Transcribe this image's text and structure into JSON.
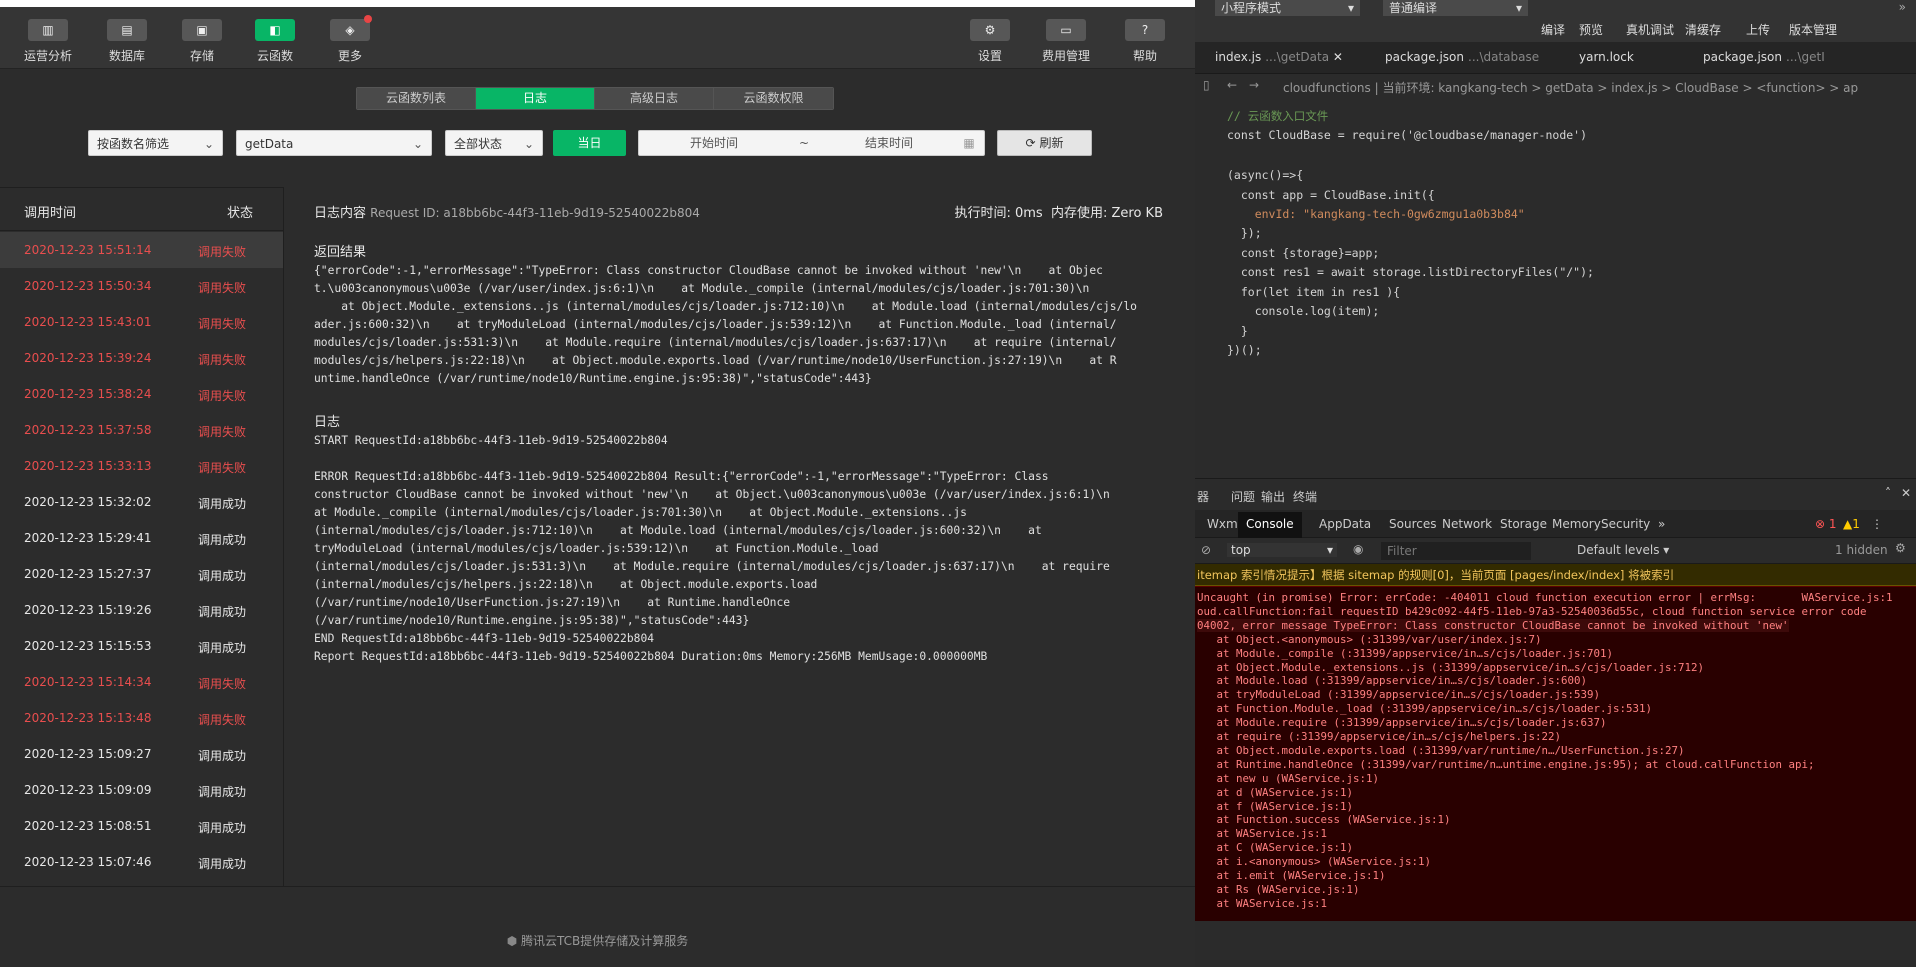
{
  "toolbar": {
    "items": [
      {
        "label": "运营分析",
        "icon": "bar-chart-icon"
      },
      {
        "label": "数据库",
        "icon": "database-icon"
      },
      {
        "label": "存储",
        "icon": "storage-icon"
      },
      {
        "label": "云函数",
        "icon": "cloud-function-icon"
      },
      {
        "label": "更多",
        "icon": "layers-icon"
      },
      {
        "label": "设置",
        "icon": "gear-icon"
      },
      {
        "label": "费用管理",
        "icon": "billing-icon"
      },
      {
        "label": "帮助",
        "icon": "help-icon"
      }
    ]
  },
  "tabs": [
    "云函数列表",
    "日志",
    "高级日志",
    "云函数权限"
  ],
  "filters": {
    "by_name": "按函数名筛选",
    "function": "getData",
    "status": "全部状态",
    "today": "当日",
    "start": "开始时间",
    "sep": "~",
    "end": "结束时间",
    "refresh": "刷新"
  },
  "list": {
    "col_time": "调用时间",
    "col_status": "状态",
    "rows": [
      {
        "time": "2020-12-23 15:51:14",
        "status": "调用失败"
      },
      {
        "time": "2020-12-23 15:50:34",
        "status": "调用失败"
      },
      {
        "time": "2020-12-23 15:43:01",
        "status": "调用失败"
      },
      {
        "time": "2020-12-23 15:39:24",
        "status": "调用失败"
      },
      {
        "time": "2020-12-23 15:38:24",
        "status": "调用失败"
      },
      {
        "time": "2020-12-23 15:37:58",
        "status": "调用失败"
      },
      {
        "time": "2020-12-23 15:33:13",
        "status": "调用失败"
      },
      {
        "time": "2020-12-23 15:32:02",
        "status": "调用成功"
      },
      {
        "time": "2020-12-23 15:29:41",
        "status": "调用成功"
      },
      {
        "time": "2020-12-23 15:27:37",
        "status": "调用成功"
      },
      {
        "time": "2020-12-23 15:19:26",
        "status": "调用成功"
      },
      {
        "time": "2020-12-23 15:15:53",
        "status": "调用成功"
      },
      {
        "time": "2020-12-23 15:14:34",
        "status": "调用失败"
      },
      {
        "time": "2020-12-23 15:13:48",
        "status": "调用失败"
      },
      {
        "time": "2020-12-23 15:09:27",
        "status": "调用成功"
      },
      {
        "time": "2020-12-23 15:09:09",
        "status": "调用成功"
      },
      {
        "time": "2020-12-23 15:08:51",
        "status": "调用成功"
      },
      {
        "time": "2020-12-23 15:07:46",
        "status": "调用成功"
      }
    ]
  },
  "detail": {
    "title": "日志内容",
    "request_id": "Request ID: a18bb6bc-44f3-11eb-9d19-52540022b804",
    "exec_time": "执行时间: 0ms",
    "memory": "内存使用: Zero KB",
    "result_title": "返回结果",
    "result_lines": [
      "{\"errorCode\":-1,\"errorMessage\":\"TypeError: Class constructor CloudBase cannot be invoked without 'new'\\n    at Objec",
      "t.\\u003canonymous\\u003e (/var/user/index.js:6:1)\\n    at Module._compile (internal/modules/cjs/loader.js:701:30)\\n",
      "    at Object.Module._extensions..js (internal/modules/cjs/loader.js:712:10)\\n    at Module.load (internal/modules/cjs/lo",
      "ader.js:600:32)\\n    at tryModuleLoad (internal/modules/cjs/loader.js:539:12)\\n    at Function.Module._load (internal/",
      "modules/cjs/loader.js:531:3)\\n    at Module.require (internal/modules/cjs/loader.js:637:17)\\n    at require (internal/",
      "modules/cjs/helpers.js:22:18)\\n    at Object.module.exports.load (/var/runtime/node10/UserFunction.js:27:19)\\n    at R",
      "untime.handleOnce (/var/runtime/node10/Runtime.engine.js:95:38)\",\"statusCode\":443}"
    ],
    "log_title": "日志",
    "log_lines": [
      "START RequestId:a18bb6bc-44f3-11eb-9d19-52540022b804",
      "",
      "ERROR RequestId:a18bb6bc-44f3-11eb-9d19-52540022b804 Result:{\"errorCode\":-1,\"errorMessage\":\"TypeError: Class",
      "constructor CloudBase cannot be invoked without 'new'\\n    at Object.\\u003canonymous\\u003e (/var/user/index.js:6:1)\\n",
      "at Module._compile (internal/modules/cjs/loader.js:701:30)\\n    at Object.Module._extensions..js",
      "(internal/modules/cjs/loader.js:712:10)\\n    at Module.load (internal/modules/cjs/loader.js:600:32)\\n    at",
      "tryModuleLoad (internal/modules/cjs/loader.js:539:12)\\n    at Function.Module._load",
      "(internal/modules/cjs/loader.js:531:3)\\n    at Module.require (internal/modules/cjs/loader.js:637:17)\\n    at require",
      "(internal/modules/cjs/helpers.js:22:18)\\n    at Object.module.exports.load",
      "(/var/runtime/node10/UserFunction.js:27:19)\\n    at Runtime.handleOnce",
      "(/var/runtime/node10/Runtime.engine.js:95:38)\",\"statusCode\":443}",
      "END RequestId:a18bb6bc-44f3-11eb-9d19-52540022b804",
      "Report RequestId:a18bb6bc-44f3-11eb-9d19-52540022b804 Duration:0ms Memory:256MB MemUsage:0.000000MB"
    ]
  },
  "footer": "腾讯云TCB提供存储及计算服务",
  "ide": {
    "mode": "小程序模式",
    "compile": "普通编译",
    "actions": [
      "编译",
      "预览",
      "真机调试",
      "清缓存",
      "上传",
      "版本管理"
    ],
    "tabs": [
      {
        "name": "index.js",
        "dir": "...\\getData"
      },
      {
        "name": "package.json",
        "dir": "...\\database"
      },
      {
        "name": "yarn.lock",
        "dir": ""
      },
      {
        "name": "package.json",
        "dir": "...\\getI"
      }
    ],
    "breadcrumb": "cloudfunctions | 当前环境: kangkang-tech > getData > index.js > CloudBase > <function> > ap",
    "code": [
      {
        "n": "",
        "c": "// 云函数入口文件"
      },
      {
        "n": "",
        "c": "const CloudBase = require('@cloudbase/manager-node')"
      },
      {
        "n": "",
        "c": ""
      },
      {
        "n": "",
        "c": "(async()=>{"
      },
      {
        "n": "",
        "c": "  const app = CloudBase.init({"
      },
      {
        "n": "",
        "c": "    envId: \"kangkang-tech-0gw6zmgu1a0b3b84\""
      },
      {
        "n": "",
        "c": "  });"
      },
      {
        "n": "",
        "c": "  const {storage}=app;"
      },
      {
        "n": "",
        "c": "  const res1 = await storage.listDirectoryFiles(\"/\");"
      },
      {
        "n": "",
        "c": "  for(let item in res1 ){"
      },
      {
        "n": "",
        "c": "    console.log(item);"
      },
      {
        "n": "",
        "c": "  }"
      },
      {
        "n": "",
        "c": "})();"
      }
    ],
    "panel_tabs": [
      "器",
      "问题",
      "输出",
      "终端"
    ],
    "devtools_tabs": [
      "Wxml",
      "Console",
      "AppData",
      "Sources",
      "Network",
      "Storage",
      "Memory",
      "Security"
    ],
    "errors": "1",
    "warnings": "1",
    "context": "top",
    "filter_placeholder": "Filter",
    "levels": "Default levels",
    "hidden": "1 hidden",
    "warning_line": "itemap 索引情况提示】根据 sitemap 的规则[0]，当前页面 [pages/index/index] 将被索引",
    "error_lines": [
      "Uncaught (in promise) Error: errCode: -404011 cloud function execution error | errMsg:       WAService.js:1",
      "oud.callFunction:fail requestID b429c092-44f5-11eb-97a3-52540036d55c, cloud function service error code",
      "04002, error message TypeError: Class constructor CloudBase cannot be invoked without 'new'",
      "   at Object.<anonymous> (:31399/var/user/index.js:7)",
      "   at Module._compile (:31399/appservice/in…s/cjs/loader.js:701)",
      "   at Object.Module._extensions..js (:31399/appservice/in…s/cjs/loader.js:712)",
      "   at Module.load (:31399/appservice/in…s/cjs/loader.js:600)",
      "   at tryModuleLoad (:31399/appservice/in…s/cjs/loader.js:539)",
      "   at Function.Module._load (:31399/appservice/in…s/cjs/loader.js:531)",
      "   at Module.require (:31399/appservice/in…s/cjs/loader.js:637)",
      "   at require (:31399/appservice/in…s/cjs/helpers.js:22)",
      "   at Object.module.exports.load (:31399/var/runtime/n…/UserFunction.js:27)",
      "   at Runtime.handleOnce (:31399/var/runtime/n…untime.engine.js:95); at cloud.callFunction api;",
      "   at new u (WAService.js:1)",
      "   at d (WAService.js:1)",
      "   at f (WAService.js:1)",
      "   at Function.success (WAService.js:1)",
      "   at WAService.js:1",
      "   at C (WAService.js:1)",
      "   at i.<anonymous> (WAService.js:1)",
      "   at i.emit (WAService.js:1)",
      "   at Rs (WAService.js:1)",
      "   at WAService.js:1"
    ]
  },
  "colors": {
    "accent": "#08b566",
    "fail": "#e94e4e"
  }
}
